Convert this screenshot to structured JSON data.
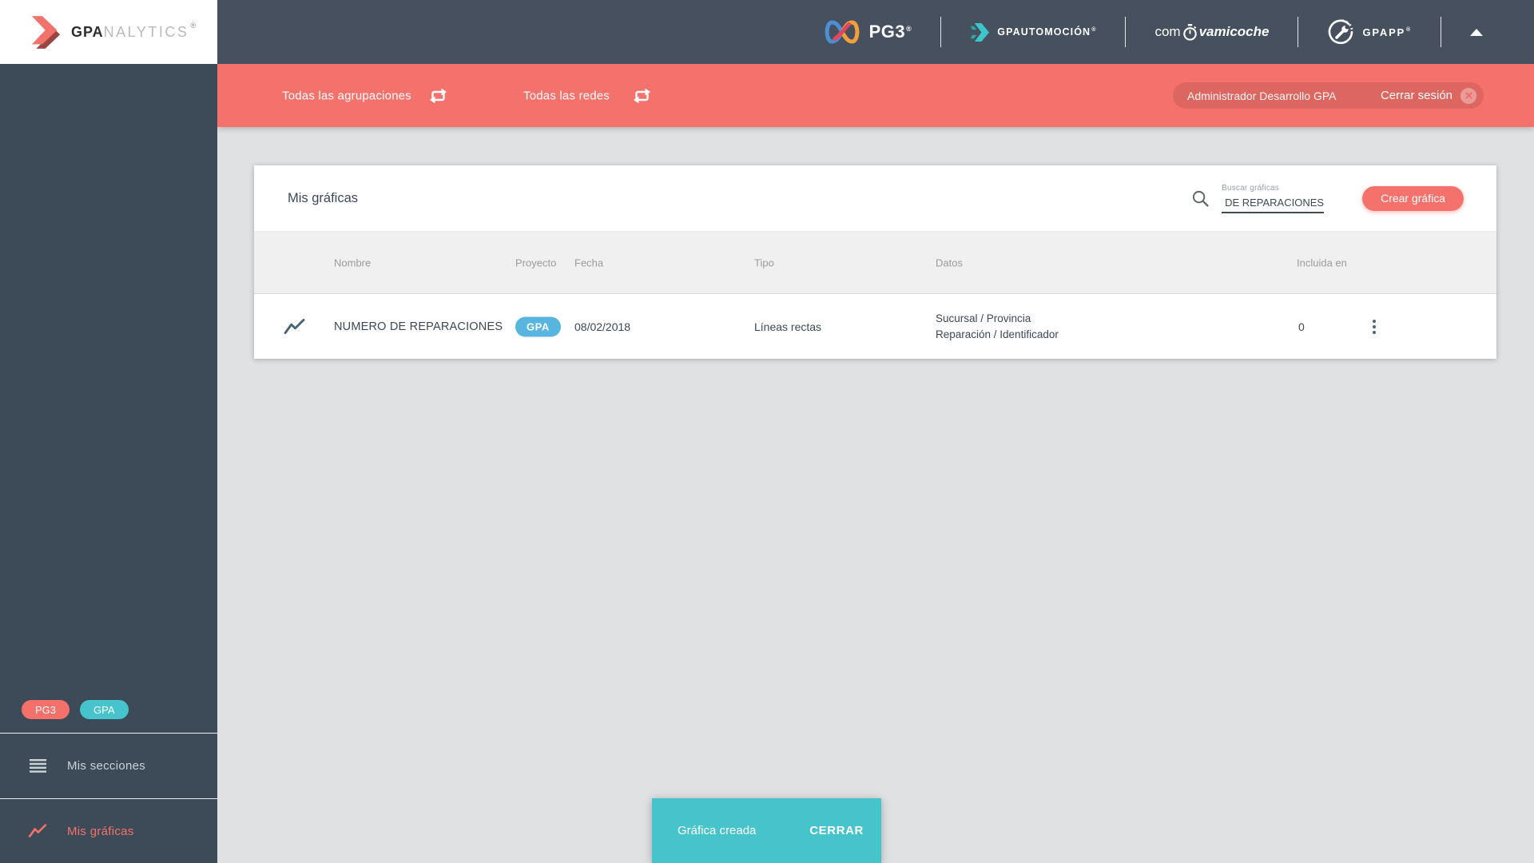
{
  "colors": {
    "accent_salmon": "#f5716c",
    "teal": "#47c4cb",
    "project_badge_blue": "#58b5e0",
    "header_dark": "#46505f",
    "sidebar_dark": "#3d4b59"
  },
  "brand": {
    "logo_bold": "GPA",
    "logo_light": "NALYTICS",
    "registered": "®"
  },
  "topbar": {
    "pg3": {
      "label": "PG3",
      "registered": "®"
    },
    "gpautomocion": {
      "label": "GPAUTOMOCIÓN",
      "registered": "®"
    },
    "compravamicoche": {
      "prefix": "com",
      "suffix": "vamicoche"
    },
    "gpapp": {
      "label": "GPAPP",
      "registered": "®"
    }
  },
  "filterbar": {
    "groupings": "Todas las agrupaciones",
    "networks": "Todas las redes",
    "user": "Administrador Desarrollo GPA",
    "logout": "Cerrar sesión"
  },
  "sidebar": {
    "badges": [
      {
        "label": "PG3"
      },
      {
        "label": "GPA"
      }
    ],
    "items": [
      {
        "label": "Mis secciones"
      },
      {
        "label": "Mis gráficas"
      }
    ]
  },
  "page": {
    "title": "Mis gráficas",
    "search_label": "Buscar gráficas",
    "search_value": "DE REPARACIONES",
    "create_button": "Crear gráfica"
  },
  "table": {
    "columns": [
      "Nombre",
      "Proyecto",
      "Fecha",
      "Tipo",
      "Datos",
      "Incluida en"
    ],
    "rows": [
      {
        "name": "NUMERO DE REPARACIONES",
        "project": "GPA",
        "date": "08/02/2018",
        "type": "Líneas rectas",
        "data_line1": "Sucursal / Provincia",
        "data_line2": "Reparación / Identificador",
        "included_in": "0"
      }
    ]
  },
  "snackbar": {
    "message": "Gráfica creada",
    "action": "CERRAR"
  }
}
